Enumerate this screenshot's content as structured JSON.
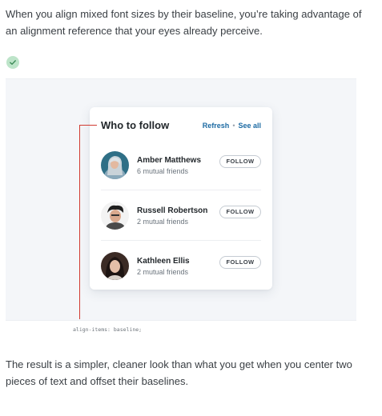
{
  "intro_text": "When you align mixed font sizes by their baseline, you’re taking advantage of an alignment reference that your eyes already perceive.",
  "status_icon": "check-circle-icon",
  "colors": {
    "check_bg": "#bde4c9",
    "check_mark": "#3c8a57",
    "guide": "#d13b32",
    "link": "#1c6aa3",
    "panel_bg": "#f4f6f9"
  },
  "card": {
    "title": "Who to follow",
    "refresh_label": "Refresh",
    "separator": "•",
    "see_all_label": "See all",
    "people": [
      {
        "name": "Amber Matthews",
        "subtitle": "6 mutual friends",
        "button": "FOLLOW",
        "avatar": "avatar-amber"
      },
      {
        "name": "Russell Robertson",
        "subtitle": "2 mutual friends",
        "button": "FOLLOW",
        "avatar": "avatar-russell"
      },
      {
        "name": "Kathleen Ellis",
        "subtitle": "2 mutual friends",
        "button": "FOLLOW",
        "avatar": "avatar-kathleen"
      }
    ]
  },
  "code_label": "align-items: baseline;",
  "outro_text": "The result is a simpler, cleaner look than what you get when you center two pieces of text and offset their baselines."
}
